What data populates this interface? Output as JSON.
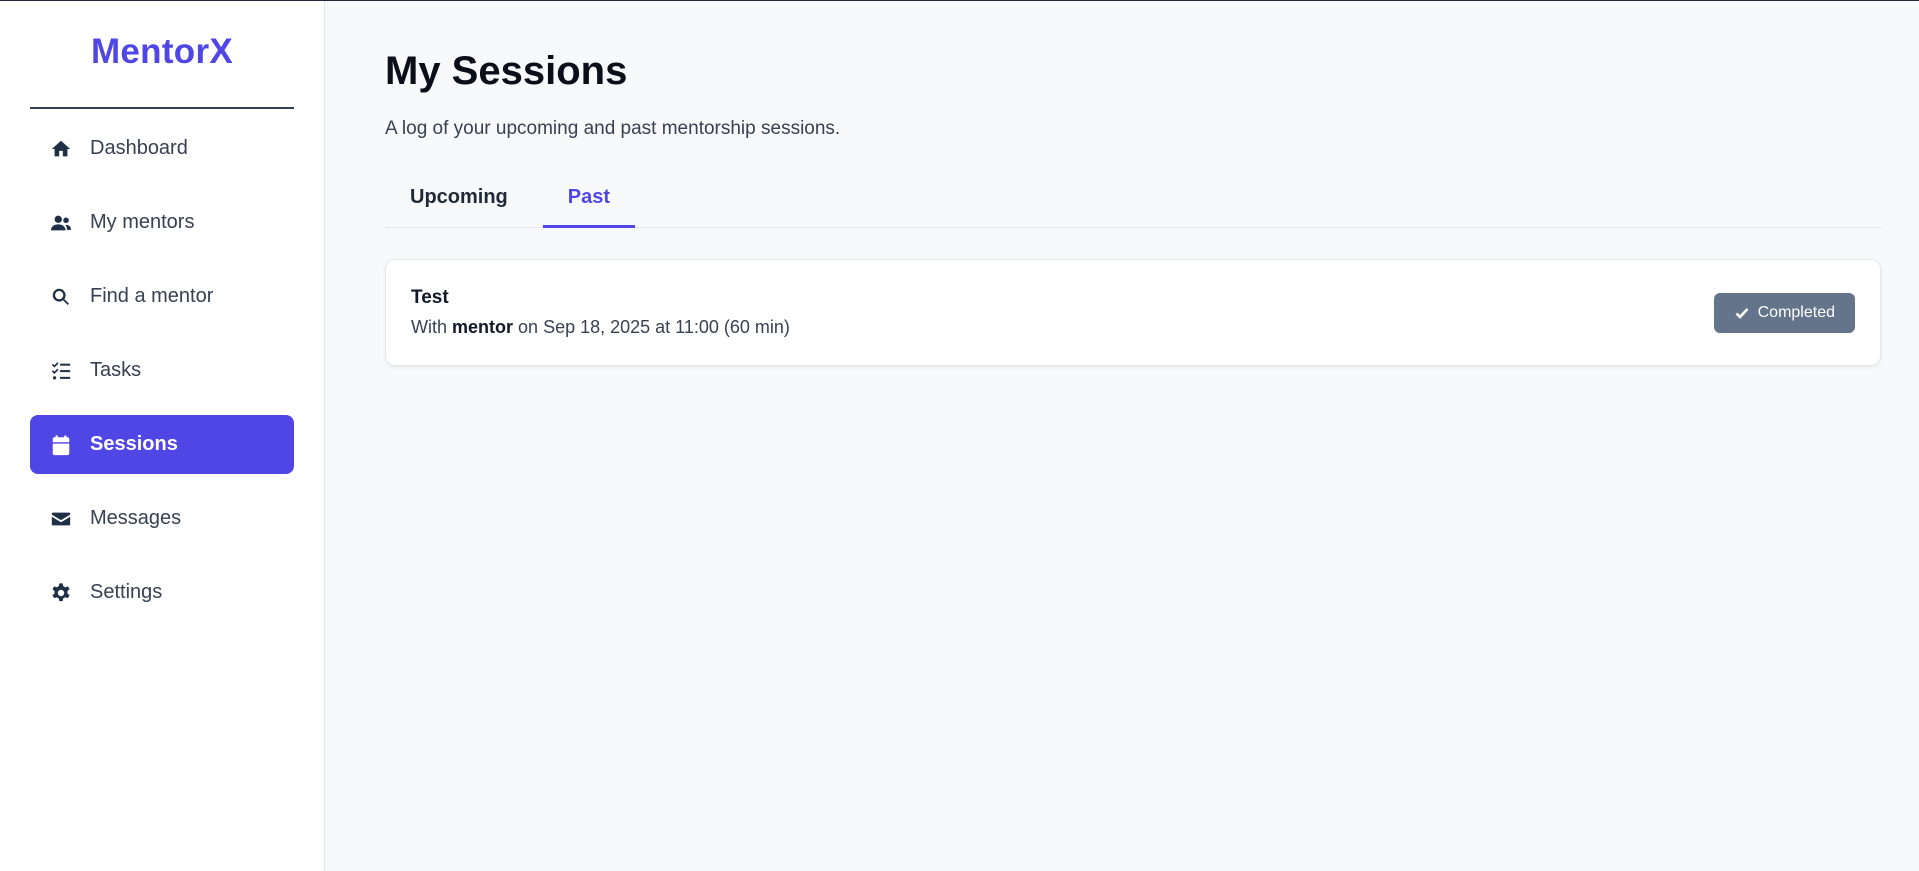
{
  "app": {
    "brand": "MentorX"
  },
  "colors": {
    "accent": "#4f46e5",
    "active_nav": "#5046e5",
    "badge": "#64748b"
  },
  "sidebar": {
    "items": [
      {
        "label": "Dashboard",
        "icon": "home-icon",
        "active": false
      },
      {
        "label": "My mentors",
        "icon": "users-icon",
        "active": false
      },
      {
        "label": "Find a mentor",
        "icon": "search-icon",
        "active": false
      },
      {
        "label": "Tasks",
        "icon": "tasks-icon",
        "active": false
      },
      {
        "label": "Sessions",
        "icon": "calendar-icon",
        "active": true
      },
      {
        "label": "Messages",
        "icon": "envelope-icon",
        "active": false
      },
      {
        "label": "Settings",
        "icon": "gear-icon",
        "active": false
      }
    ]
  },
  "main": {
    "title": "My Sessions",
    "subtitle": "A log of your upcoming and past mentorship sessions.",
    "tabs": [
      {
        "label": "Upcoming",
        "active": false
      },
      {
        "label": "Past",
        "active": true
      }
    ],
    "sessions": [
      {
        "title": "Test",
        "with_prefix": "With",
        "mentor": "mentor",
        "when": "on Sep 18, 2025 at 11:00 (60 min)",
        "status": "Completed",
        "status_icon": "check-icon"
      }
    ]
  }
}
